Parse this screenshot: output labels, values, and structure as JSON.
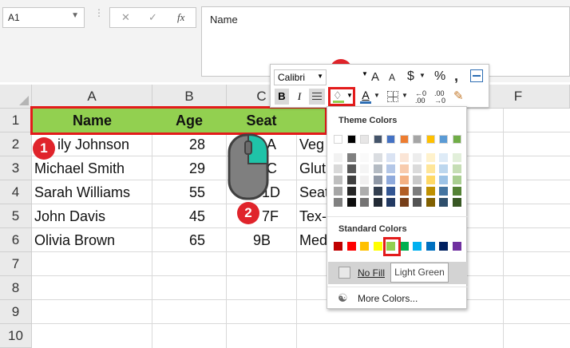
{
  "formula_bar": {
    "name_box": "A1",
    "cancel_symbol": "✕",
    "enter_symbol": "✓",
    "fx_label": "fx",
    "content": "Name"
  },
  "columns": [
    "A",
    "B",
    "C",
    "D",
    "E",
    "F"
  ],
  "rows": [
    "1",
    "2",
    "3",
    "4",
    "5",
    "6",
    "7",
    "8",
    "9",
    "10"
  ],
  "table": {
    "header": [
      "Name",
      "Age",
      "Seat"
    ],
    "rows": [
      {
        "name": "ily Johnson",
        "age": "28",
        "seat": "A",
        "extra": "Veg"
      },
      {
        "name": "Michael Smith",
        "age": "29",
        "seat": "C",
        "extra": "Glut"
      },
      {
        "name": "Sarah Williams",
        "age": "55",
        "seat": "1D",
        "extra": "Seat"
      },
      {
        "name": "John Davis",
        "age": "45",
        "seat": "7F",
        "extra": "Tex-"
      },
      {
        "name": "Olivia Brown",
        "age": "65",
        "seat": "9B",
        "extra": "Med"
      }
    ]
  },
  "badges": [
    "1",
    "2",
    "4"
  ],
  "mini_toolbar": {
    "font": "Calibri",
    "increase_font": "A",
    "decrease_font": "A",
    "currency": "$",
    "percent": "%",
    "comma": "̧",
    "bold": "B",
    "italic": "I",
    "font_color_letter": "A",
    "dec_increase": "←.0",
    "dec_decrease": ".00",
    "dropdown_arrow": "⌵"
  },
  "dropdown": {
    "theme_title": "Theme Colors",
    "standard_title": "Standard Colors",
    "no_fill": "No Fill",
    "tooltip": "Light Green",
    "more_colors": "More Colors..."
  },
  "colors": {
    "header_fill": "#92d050",
    "highlight": "#e31b1b",
    "theme_top": [
      "#ffffff",
      "#000000",
      "#e7e6e6",
      "#44546a",
      "#4472c4",
      "#ed7d31",
      "#a5a5a5",
      "#ffc000",
      "#5b9bd5",
      "#70ad47"
    ],
    "standard": [
      "#c00000",
      "#ff0000",
      "#ffc000",
      "#ffff00",
      "#92d050",
      "#00b050",
      "#00b0f0",
      "#0070c0",
      "#002060",
      "#7030a0"
    ]
  }
}
